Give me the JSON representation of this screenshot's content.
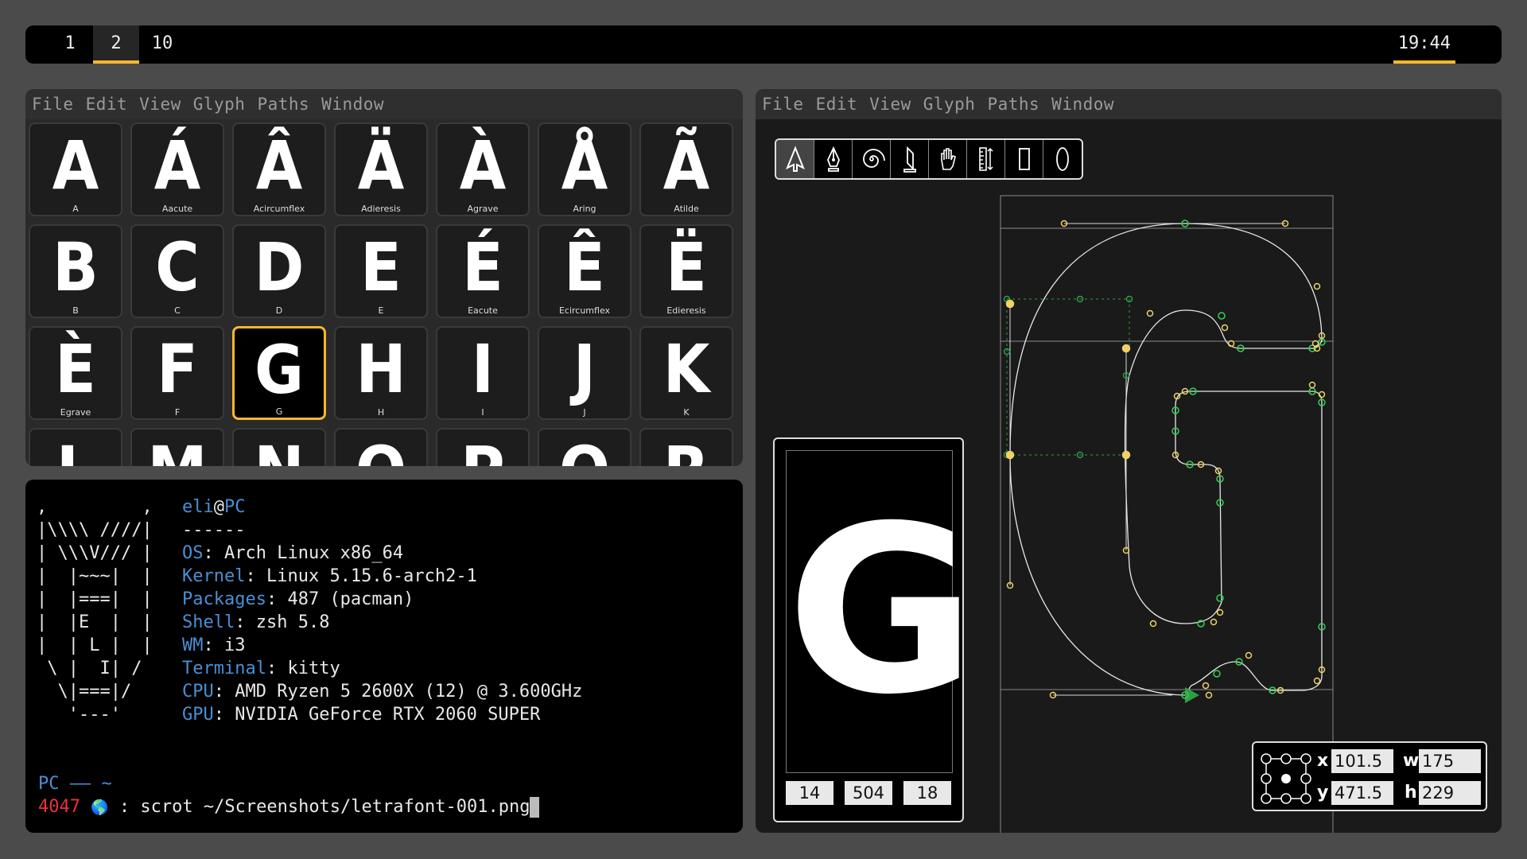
{
  "topbar": {
    "workspaces": [
      {
        "label": "1",
        "active": false
      },
      {
        "label": "2",
        "active": true
      },
      {
        "label": "10",
        "active": false
      }
    ],
    "clock": "19:44",
    "accent": "#f5b82e"
  },
  "glyph_window": {
    "menu": [
      "File",
      "Edit",
      "View",
      "Glyph",
      "Paths",
      "Window"
    ],
    "selected": "G",
    "rows": [
      [
        {
          "ch": "A",
          "name": "A"
        },
        {
          "ch": "Á",
          "name": "Aacute"
        },
        {
          "ch": "Â",
          "name": "Acircumflex"
        },
        {
          "ch": "Ä",
          "name": "Adieresis"
        },
        {
          "ch": "À",
          "name": "Agrave"
        },
        {
          "ch": "Å",
          "name": "Aring"
        },
        {
          "ch": "Ã",
          "name": "Atilde"
        }
      ],
      [
        {
          "ch": "B",
          "name": "B"
        },
        {
          "ch": "C",
          "name": "C"
        },
        {
          "ch": "D",
          "name": "D"
        },
        {
          "ch": "E",
          "name": "E"
        },
        {
          "ch": "É",
          "name": "Eacute"
        },
        {
          "ch": "Ê",
          "name": "Ecircumflex"
        },
        {
          "ch": "Ë",
          "name": "Edieresis"
        }
      ],
      [
        {
          "ch": "È",
          "name": "Egrave"
        },
        {
          "ch": "F",
          "name": "F"
        },
        {
          "ch": "G",
          "name": "G"
        },
        {
          "ch": "H",
          "name": "H"
        },
        {
          "ch": "I",
          "name": "I"
        },
        {
          "ch": "J",
          "name": "J"
        },
        {
          "ch": "K",
          "name": "K"
        }
      ],
      [
        {
          "ch": "L",
          "name": ""
        },
        {
          "ch": "M",
          "name": ""
        },
        {
          "ch": "N",
          "name": ""
        },
        {
          "ch": "O",
          "name": ""
        },
        {
          "ch": "P",
          "name": ""
        },
        {
          "ch": "Q",
          "name": ""
        },
        {
          "ch": "R",
          "name": ""
        }
      ]
    ]
  },
  "terminal": {
    "ascii_art": [
      ",         ,",
      "|\\\\\\\\ ////|",
      "| \\\\\\V/// |",
      "|  |~~~|  |",
      "|  |===|  |",
      "|  |E  |  |",
      "|  | L |  |",
      " \\ |  I| /",
      "  \\|===|/",
      "   '---'"
    ],
    "user": "eli",
    "at": "@",
    "host": "PC",
    "separator": "------",
    "info": [
      {
        "key": "OS",
        "value": ": Arch Linux x86_64"
      },
      {
        "key": "Kernel",
        "value": ": Linux 5.15.6-arch2-1"
      },
      {
        "key": "Packages",
        "value": ": 487 (pacman)"
      },
      {
        "key": "Shell",
        "value": ": zsh 5.8"
      },
      {
        "key": "WM",
        "value": ": i3"
      },
      {
        "key": "Terminal",
        "value": ": kitty"
      },
      {
        "key": "CPU",
        "value": ": AMD Ryzen 5 2600X (12) @ 3.600GHz"
      },
      {
        "key": "GPU",
        "value": ": NVIDIA GeForce RTX 2060 SUPER"
      }
    ],
    "prompt_line1": "PC —— ~",
    "prompt_pid": "4047",
    "prompt_globe": "🌎",
    "prompt_command": " : scrot ~/Screenshots/letrafont-001.png",
    "key_color": "#4a8fd6",
    "pid_color": "#e8343a"
  },
  "editor_window": {
    "menu": [
      "File",
      "Edit",
      "View",
      "Glyph",
      "Paths",
      "Window"
    ],
    "tools": [
      {
        "icon": "pointer-arrow-icon",
        "active": true
      },
      {
        "icon": "pen-nib-icon",
        "active": false
      },
      {
        "icon": "spiral-icon",
        "active": false
      },
      {
        "icon": "pencil-icon",
        "active": false
      },
      {
        "icon": "hand-icon",
        "active": false
      },
      {
        "icon": "ruler-icon",
        "active": false
      },
      {
        "icon": "rectangle-icon",
        "active": false
      },
      {
        "icon": "ellipse-icon",
        "active": false
      }
    ],
    "preview_glyph": "G",
    "metrics": [
      "14",
      "504",
      "18"
    ],
    "coords": {
      "x_label": "x",
      "x": "101.5",
      "y_label": "y",
      "y": "471.5",
      "w_label": "w",
      "w": "175",
      "h_label": "h",
      "h": "229"
    },
    "node_color_on_curve": "#33d155",
    "node_color_handle": "#f0d264"
  }
}
